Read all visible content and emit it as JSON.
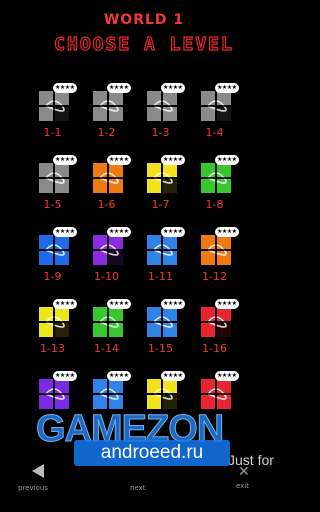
{
  "header": {
    "world": "WORLD 1",
    "subtitle": "CHOOSE A LEVEL"
  },
  "colors": {
    "accent": "#f03a3a"
  },
  "levels": [
    {
      "label": "1-1",
      "stars": "★★★★",
      "color": "#8a8a8a",
      "icon": "grey-pipe-tile"
    },
    {
      "label": "1-2",
      "stars": "★★★★",
      "color": "#8a8a8a",
      "icon": "grey-pipe-tile"
    },
    {
      "label": "1-3",
      "stars": "★★★★",
      "color": "#8a8a8a",
      "icon": "grey-loop-tile"
    },
    {
      "label": "1-4",
      "stars": "★★★★",
      "color": "#8a8a8a",
      "icon": "grey-curve-tile"
    },
    {
      "label": "1-5",
      "stars": "★★★★",
      "color": "#8a8a8a",
      "icon": "grey-pipe-tile"
    },
    {
      "label": "1-6",
      "stars": "★★★★",
      "color": "#f07a10",
      "icon": "orange-curve-tile"
    },
    {
      "label": "1-7",
      "stars": "★★★★",
      "color": "#f2e21a",
      "icon": "yellow-pipe-tile"
    },
    {
      "label": "1-8",
      "stars": "★★★★",
      "color": "#37c82f",
      "icon": "green-curve-tile"
    },
    {
      "label": "1-9",
      "stars": "★★★★",
      "color": "#1e6be8",
      "icon": "blue-pipe-tile"
    },
    {
      "label": "1-10",
      "stars": "★★★★",
      "color": "#8a2be2",
      "icon": "purple-pipe-tile"
    },
    {
      "label": "1-11",
      "stars": "★★★★",
      "color": "#2e82e8",
      "icon": "blue-t-tile"
    },
    {
      "label": "1-12",
      "stars": "★★★★",
      "color": "#f07a10",
      "icon": "orange-curve-tile"
    },
    {
      "label": "1-13",
      "stars": "★★★★",
      "color": "#e8e81a",
      "icon": "yellow-cross-tile"
    },
    {
      "label": "1-14",
      "stars": "★★★★",
      "color": "#37c82f",
      "icon": "green-pipe-tile"
    },
    {
      "label": "1-15",
      "stars": "★★★★",
      "color": "#2e82e8",
      "icon": "blue-loop-tile"
    },
    {
      "label": "1-16",
      "stars": "★★★★",
      "color": "#e8262f",
      "icon": "red-loop-tile"
    },
    {
      "label": "",
      "stars": "★★★★",
      "color": "#7a2be2",
      "icon": "purple-pipe-tile"
    },
    {
      "label": "",
      "stars": "★★★★",
      "color": "#2e82e8",
      "icon": "blue-pipe-tile"
    },
    {
      "label": "",
      "stars": "★★★★",
      "color": "#f2e21a",
      "icon": "yellow-pipe-tile"
    },
    {
      "label": "",
      "stars": "★★★★",
      "color": "#e8262f",
      "icon": "red-pipe-tile"
    }
  ],
  "watermark": {
    "brand": "GAMEZON",
    "suffix": "Just for",
    "site": "androeed.ru"
  },
  "nav": {
    "previous": "previous",
    "next": "next",
    "exit": "exit"
  }
}
